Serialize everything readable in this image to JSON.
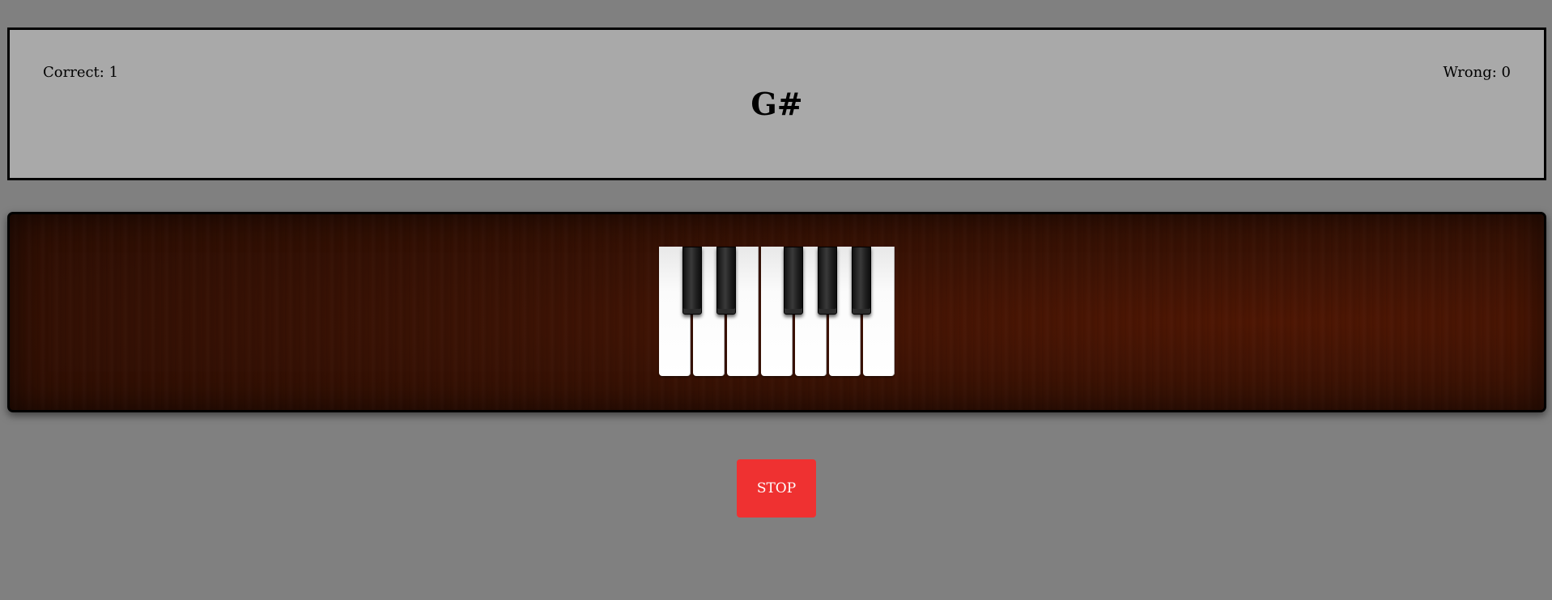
{
  "scoreboard": {
    "correct_text": "Correct: 1",
    "wrong_text": "Wrong: 0",
    "current_note": "G#"
  },
  "piano": {
    "white_keys": [
      "C",
      "D",
      "E",
      "F",
      "G",
      "A",
      "B"
    ],
    "black_keys": [
      "C#",
      "D#",
      "F#",
      "G#",
      "A#"
    ]
  },
  "controls": {
    "stop_label": "STOP"
  },
  "colors": {
    "background": "#808080",
    "scoreboard": "#a9a9a9",
    "stop_button": "#ef3131",
    "wood": "#3a1204"
  }
}
